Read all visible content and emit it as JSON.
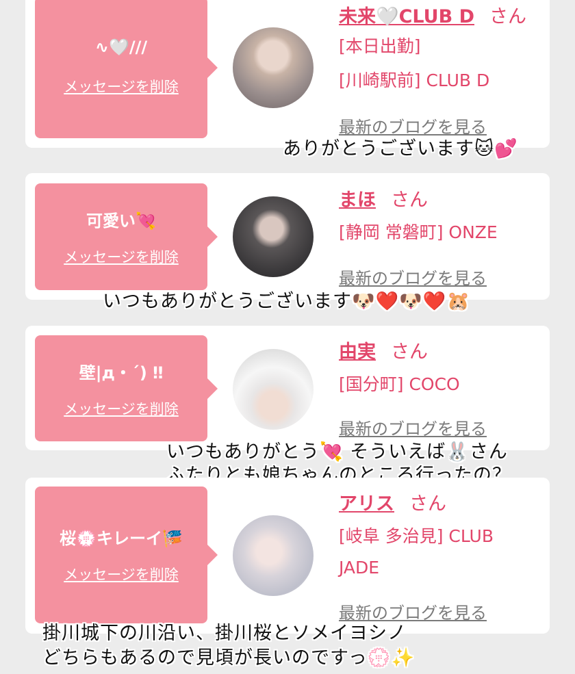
{
  "entries": [
    {
      "message": "∿🤍///",
      "delete_label": "メッセージを削除",
      "name": "未来🤍CLUB D",
      "honorific": "さん",
      "info": [
        "[本日出勤]",
        "[川崎駅前] CLUB D"
      ],
      "blog_label": "最新のブログを見る",
      "avatar": "avatar-photo"
    },
    {
      "message": "可愛い💘",
      "delete_label": "メッセージを削除",
      "name": "まほ",
      "honorific": "さん",
      "info": [
        "[静岡 常磐町] ONZE"
      ],
      "blog_label": "最新のブログを見る",
      "avatar": "avatar-photo"
    },
    {
      "message": "壁|д・´) ‼",
      "delete_label": "メッセージを削除",
      "name": "由実",
      "honorific": "さん",
      "info": [
        "[国分町] COCO"
      ],
      "blog_label": "最新のブログを見る",
      "avatar": "avatar-photo"
    },
    {
      "message": "桜💮キレーイ🎏",
      "delete_label": "メッセージを削除",
      "name": "アリス",
      "honorific": "さん",
      "info": [
        "[岐阜 多治見] CLUB",
        "JADE"
      ],
      "blog_label": "最新のブログを見る",
      "avatar": "avatar-photo"
    }
  ],
  "captions": {
    "c1": "ありがとうございます🐱💕",
    "c2": "いつもありがとうございます🐶❤️🐶❤️🐹",
    "c3_line1": "いつもありがとう💘 そういえば🐰さん",
    "c3_line2": "ふたりとも娘ちゃんのところ行ったの？",
    "c4_line1": "掛川城下の川沿い、掛川桜とソメイヨシノ",
    "c4_line2": "どちらもあるので見頃が長いのですっ💮✨"
  },
  "colors": {
    "accent": "#e2466a",
    "bubble": "#f4919f",
    "background": "#ececec"
  }
}
